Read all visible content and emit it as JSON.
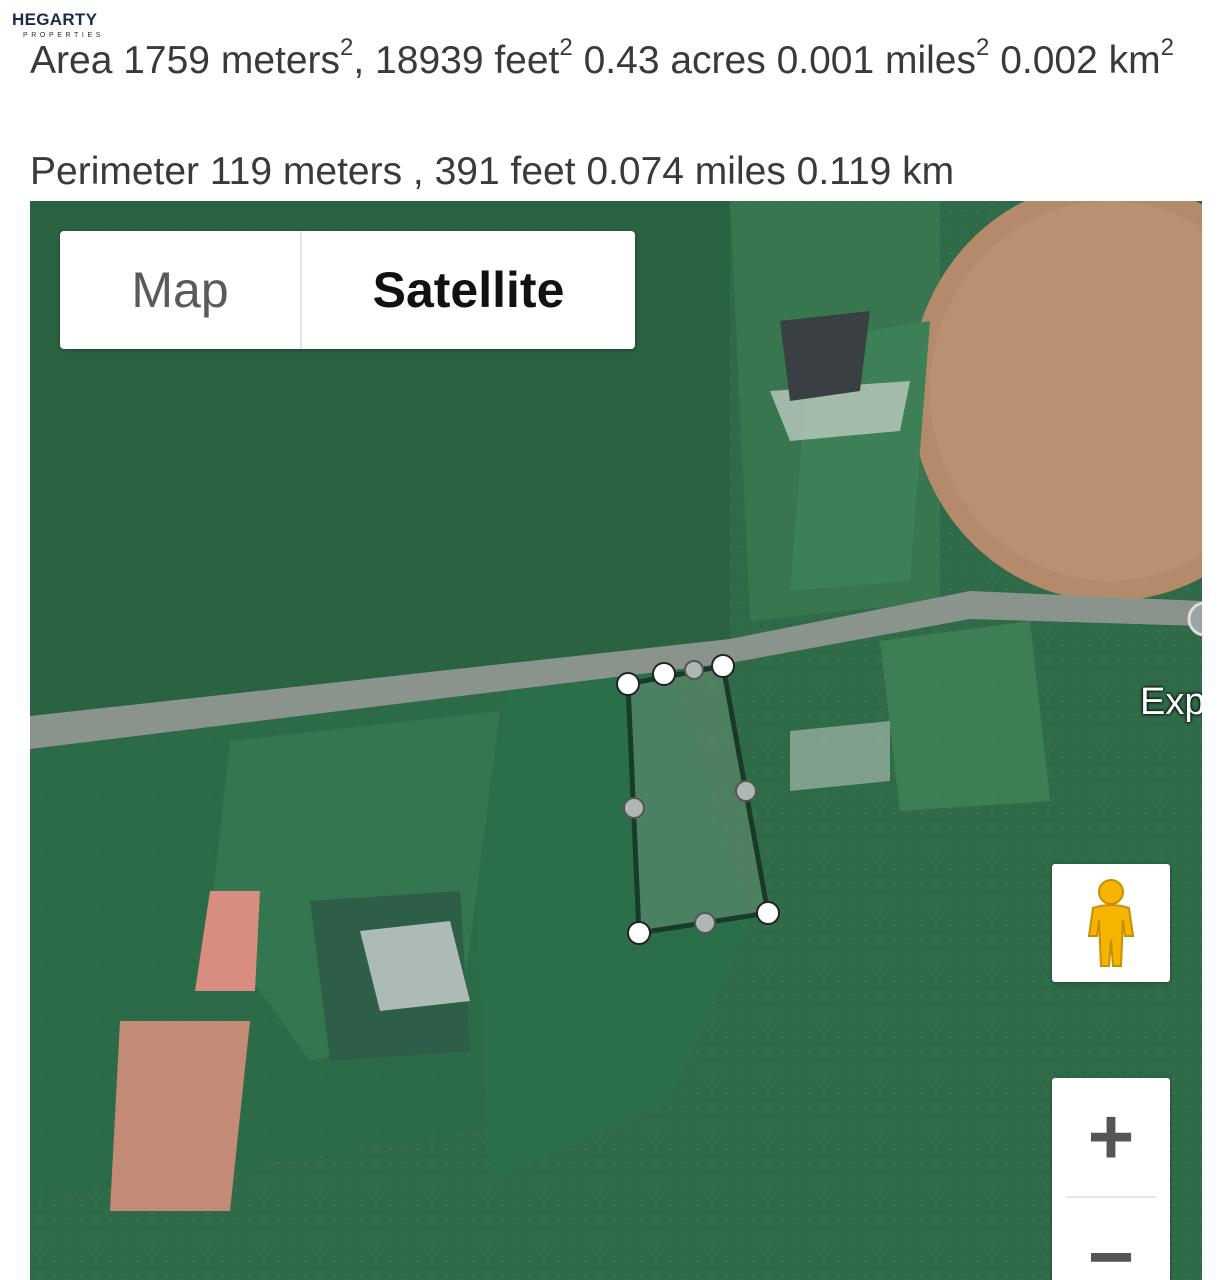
{
  "logo": {
    "name": "HEGARTY",
    "sub": "PROPERTIES"
  },
  "measurements": {
    "area": {
      "label": "Area",
      "meters": "1759 meters",
      "feet": ", 18939 feet",
      "acres": "0.43 acres",
      "miles": "0.001 miles",
      "km": "0.002 km",
      "squared": "2"
    },
    "perimeter": {
      "text": "Perimeter 119 meters , 391 feet 0.074 miles 0.119 km"
    }
  },
  "map": {
    "type_control": {
      "map_label": "Map",
      "satellite_label": "Satellite",
      "selected": "Satellite"
    },
    "place_label": "Exp",
    "zoom": {
      "in_label": "+",
      "out_label": "−"
    },
    "icons": [
      "pegman-icon",
      "zoom-in-icon",
      "zoom-out-icon"
    ],
    "colors": {
      "grass": "#2f6b49",
      "road": "#8a948c",
      "plot_outline": "#000000",
      "field_brown": "#b58a6a"
    }
  }
}
